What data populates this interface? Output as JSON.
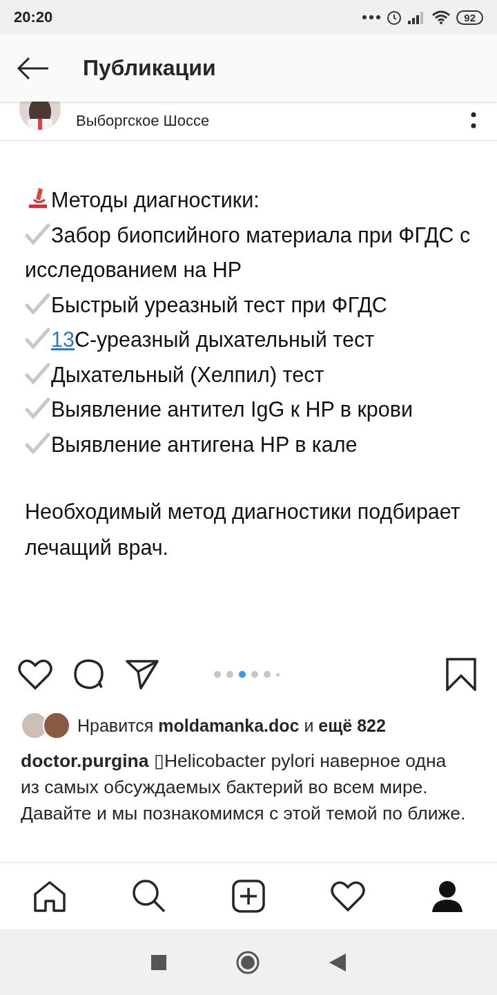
{
  "status_bar": {
    "time": "20:20",
    "battery": "92"
  },
  "header": {
    "title": "Публикации"
  },
  "post": {
    "location": "Выборгское Шоссе",
    "image_lines": [
      {
        "kind": "heading",
        "text": "Методы диагностики:"
      },
      {
        "kind": "check",
        "text": "Забор биопсийного материала при ФГДС с исследованием на HP"
      },
      {
        "kind": "check",
        "text": "Быстрый уреазный тест при ФГДС"
      },
      {
        "kind": "check",
        "link": "13",
        "text": "С-уреазный дыхательный тест"
      },
      {
        "kind": "check",
        "text": "Дыхательный (Хелпил) тест"
      },
      {
        "kind": "check",
        "text": "Выявление антител IgG к HP в крови"
      },
      {
        "kind": "check",
        "text": "Выявление антигена HP в кале"
      }
    ],
    "image_note": "Необходимый метод диагностики подбирает лечащий врач.",
    "carousel_dots": [
      {
        "selected": false
      },
      {
        "selected": false
      },
      {
        "selected": true
      },
      {
        "selected": false
      },
      {
        "selected": false
      },
      {
        "selected": false
      }
    ],
    "likes": "Нравится **moldamanka.doc** и **ещё 822**",
    "caption_user": "doctor.purgina",
    "caption": "▯Helicobacter pylori наверное одна из самых обсуждаемых бактерий во всем мире. Давайте и мы познакомимся с этой темой по ближе."
  }
}
